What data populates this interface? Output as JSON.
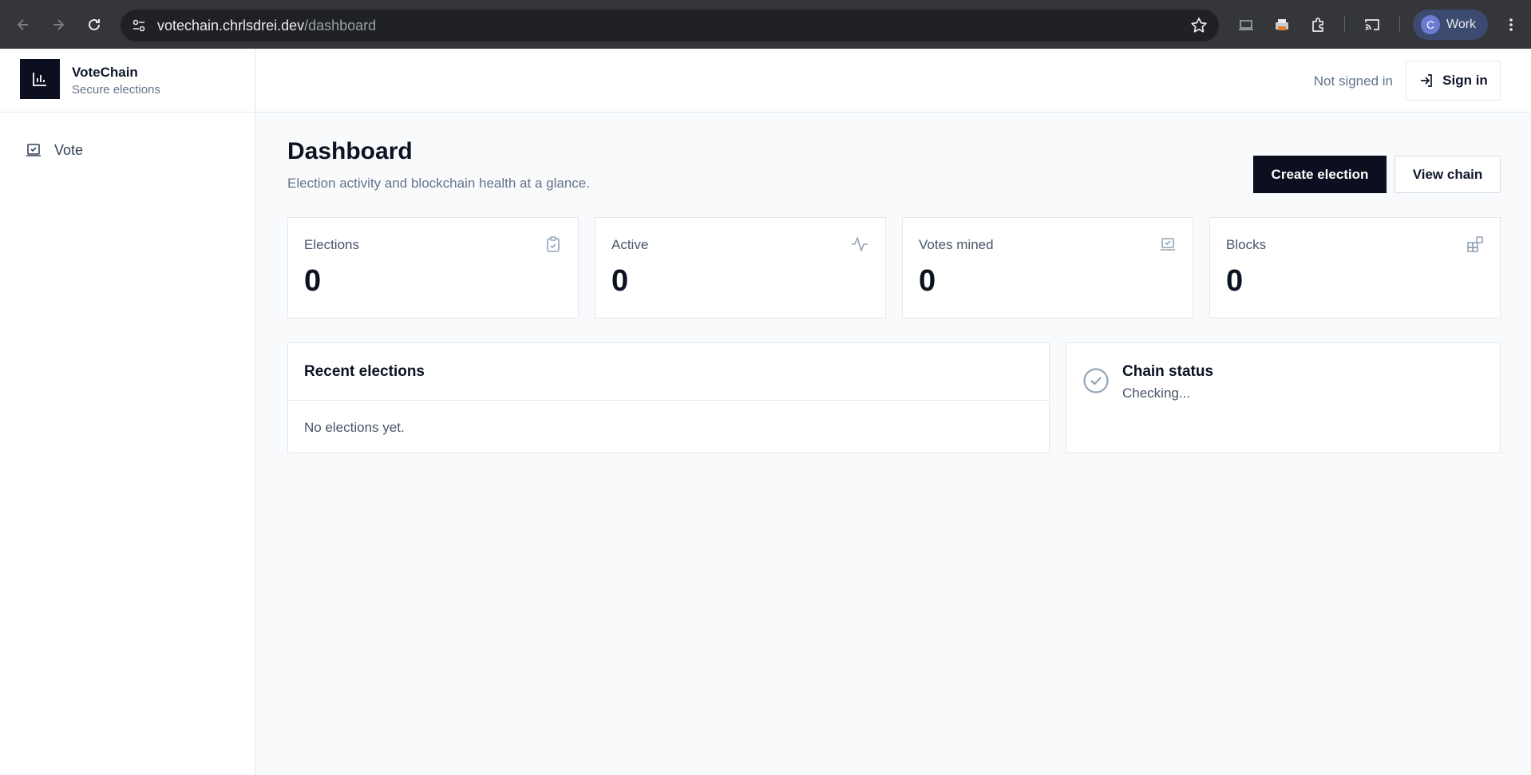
{
  "browser": {
    "url_host": "votechain.chrlsdrei.dev",
    "url_path": "/dashboard",
    "profile_initial": "C",
    "profile_label": "Work"
  },
  "brand": {
    "name": "VoteChain",
    "tagline": "Secure elections"
  },
  "sidebar": {
    "items": [
      {
        "label": "Vote",
        "icon": "vote-check-icon"
      }
    ]
  },
  "topbar": {
    "auth_status": "Not signed in",
    "signin_label": "Sign in"
  },
  "page": {
    "title": "Dashboard",
    "subtitle": "Election activity and blockchain health at a glance.",
    "primary_action": "Create election",
    "secondary_action": "View chain"
  },
  "stats": [
    {
      "label": "Elections",
      "value": "0",
      "icon": "clipboard-check-icon"
    },
    {
      "label": "Active",
      "value": "0",
      "icon": "activity-icon"
    },
    {
      "label": "Votes mined",
      "value": "0",
      "icon": "vote-check-icon"
    },
    {
      "label": "Blocks",
      "value": "0",
      "icon": "blocks-icon"
    }
  ],
  "recent_elections": {
    "title": "Recent elections",
    "empty_text": "No elections yet."
  },
  "chain_status": {
    "title": "Chain status",
    "status": "Checking..."
  },
  "colors": {
    "primary": "#0b0f1f",
    "background": "#f8fafc",
    "muted_text": "#64748b",
    "border": "#e2e8f0"
  }
}
